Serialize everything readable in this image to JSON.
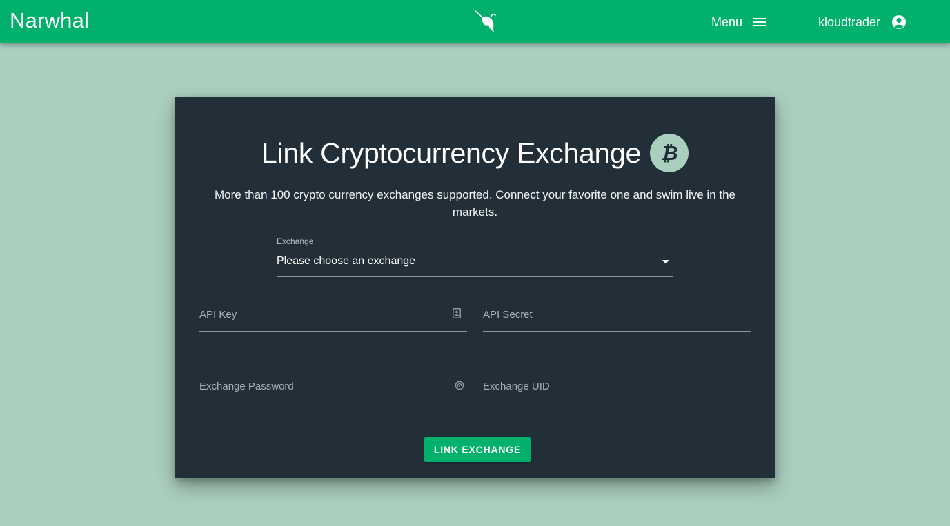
{
  "header": {
    "brand": "Narwhal",
    "logo_icon": "narwhal-icon",
    "menu_label": "Menu",
    "menu_icon": "hamburger-icon",
    "username": "kloudtrader",
    "account_icon": "account-circle-icon",
    "color": "#00b06b"
  },
  "card": {
    "title": "Link Cryptocurrency Exchange",
    "title_icon": "bitcoin-icon",
    "subtitle": "More than 100 crypto currency exchanges supported. Connect your favorite one and swim live in the markets.",
    "exchange_select": {
      "label": "Exchange",
      "value": "Please choose an exchange",
      "icon": "caret-down-icon"
    },
    "fields": [
      {
        "label": "API Key",
        "icon": "id-card-icon"
      },
      {
        "label": "API Secret"
      },
      {
        "label": "Exchange Password",
        "icon": "fingerprint-icon"
      },
      {
        "label": "Exchange UID"
      }
    ],
    "submit_label": "LINK EXCHANGE"
  },
  "colors": {
    "page_background": "#abcfbf",
    "card_background": "#232f38",
    "accent": "#00b06b"
  }
}
